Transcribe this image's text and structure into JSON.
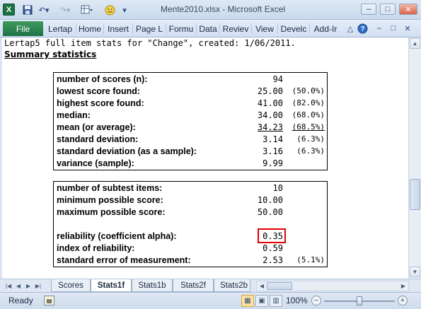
{
  "window": {
    "title": "Mente2010.xlsx - Microsoft Excel",
    "app_icon_letter": "X",
    "controls": {
      "minimize": "–",
      "restore": "□",
      "close": "✕"
    }
  },
  "quick_access": {
    "save_icon": "save-icon",
    "undo_icon": "undo-icon",
    "redo_icon": "redo-icon",
    "custom_icon": "table-icon",
    "smiley_icon": "smiley-icon",
    "dropdown_icon": "chevron-down-icon"
  },
  "ribbon": {
    "file_label": "File",
    "tabs": [
      "Lertap",
      "Home",
      "Insert",
      "Page L",
      "Formu",
      "Data",
      "Reviev",
      "View",
      "Develc",
      "Add-Ir"
    ],
    "help_icon": "help-icon",
    "right_controls": {
      "minimize": "–",
      "restore": "□",
      "close": "✕"
    }
  },
  "sheet": {
    "header_line": "Lertap5 full item stats for \"Change\", created: 1/06/2011.",
    "summary_heading": "Summary statistics",
    "box1": [
      {
        "label": "number of scores (n):",
        "value": "94",
        "pct": ""
      },
      {
        "label": "lowest score found:",
        "value": "25.00",
        "pct": "(50.0%)"
      },
      {
        "label": "highest score found:",
        "value": "41.00",
        "pct": "(82.0%)"
      },
      {
        "label": "median:",
        "value": "34.00",
        "pct": "(68.0%)"
      },
      {
        "label": "mean (or average):",
        "value": "34.23",
        "pct": "(68.5%)"
      },
      {
        "label": "standard deviation:",
        "value": "3.14",
        "pct": "(6.3%)"
      },
      {
        "label": "standard deviation (as a sample):",
        "value": "3.16",
        "pct": "(6.3%)"
      },
      {
        "label": "variance (sample):",
        "value": "9.99",
        "pct": ""
      }
    ],
    "box2": [
      {
        "label": "number of subtest items:",
        "value": "10",
        "pct": ""
      },
      {
        "label": "minimum possible score:",
        "value": "10.00",
        "pct": ""
      },
      {
        "label": "maximum possible score:",
        "value": "50.00",
        "pct": ""
      },
      {
        "label": "reliability (coefficient alpha):",
        "value": "0.35",
        "pct": ""
      },
      {
        "label": "index of reliability:",
        "value": "0.59",
        "pct": ""
      },
      {
        "label": "standard error of measurement:",
        "value": "2.53",
        "pct": "(5.1%)"
      }
    ],
    "highlight_color": "#e00000"
  },
  "sheet_tabs": {
    "tabs": [
      "Scores",
      "Stats1f",
      "Stats1b",
      "Stats2f",
      "Stats2b"
    ],
    "active": "Stats1f"
  },
  "statusbar": {
    "ready": "Ready",
    "zoom": "100%",
    "zoom_fraction": 0.5
  },
  "colors": {
    "file_tab": "#1e7145",
    "accent": "#2c4a78"
  }
}
